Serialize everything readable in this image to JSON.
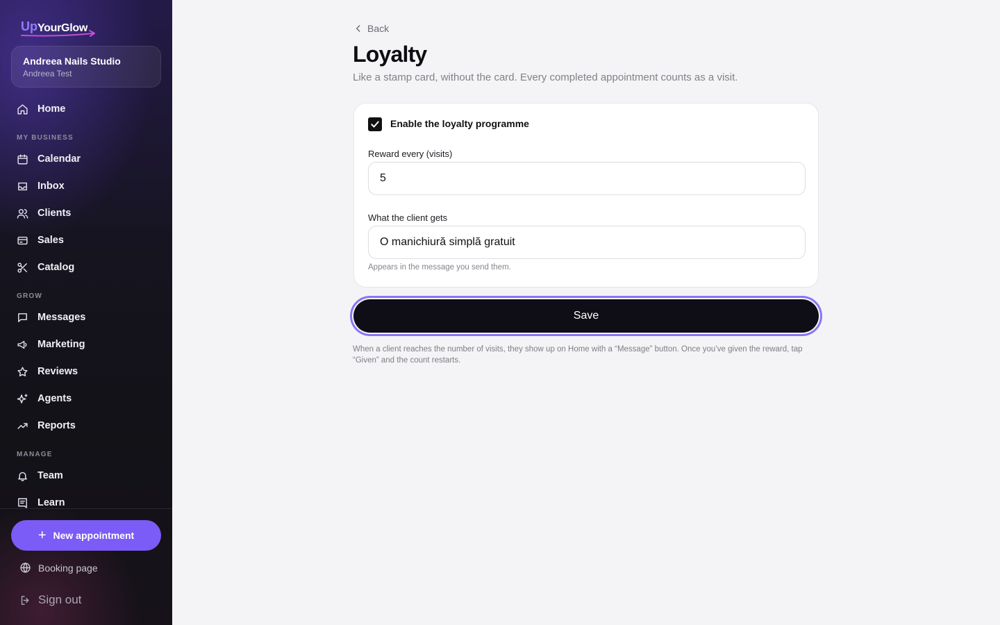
{
  "brand": {
    "up": "Up",
    "rest": "YourGlow"
  },
  "workspace": {
    "name": "Andreea Nails Studio",
    "user": "Andreea Test"
  },
  "sidebar": {
    "home": "Home",
    "sections": {
      "my_business": "MY BUSINESS",
      "grow": "GROW",
      "manage": "MANAGE"
    },
    "items": {
      "calendar": "Calendar",
      "inbox": "Inbox",
      "clients": "Clients",
      "sales": "Sales",
      "catalog": "Catalog",
      "messages": "Messages",
      "marketing": "Marketing",
      "reviews": "Reviews",
      "agents": "Agents",
      "reports": "Reports",
      "team": "Team",
      "learn": "Learn"
    },
    "new_appointment": "New appointment",
    "booking_page": "Booking page",
    "sign_out": "Sign out"
  },
  "page": {
    "back": "Back",
    "title": "Loyalty",
    "subtitle": "Like a stamp card, without the card. Every completed appointment counts as a visit."
  },
  "form": {
    "enable_label": "Enable the loyalty programme",
    "enabled": true,
    "reward_label": "Reward every (visits)",
    "reward_value": "5",
    "gift_label": "What the client gets",
    "gift_value": "O manichiură simplă gratuit",
    "gift_hint": "Appears in the message you send them.",
    "save_label": "Save",
    "footnote": "When a client reaches the number of visits, they show up on Home with a “Message” button. Once you’ve given the reward, tap “Given” and the count restarts."
  },
  "colors": {
    "accent": "#7b5cf6",
    "button_dark": "#0f0e17",
    "background": "#f4f4f6"
  }
}
